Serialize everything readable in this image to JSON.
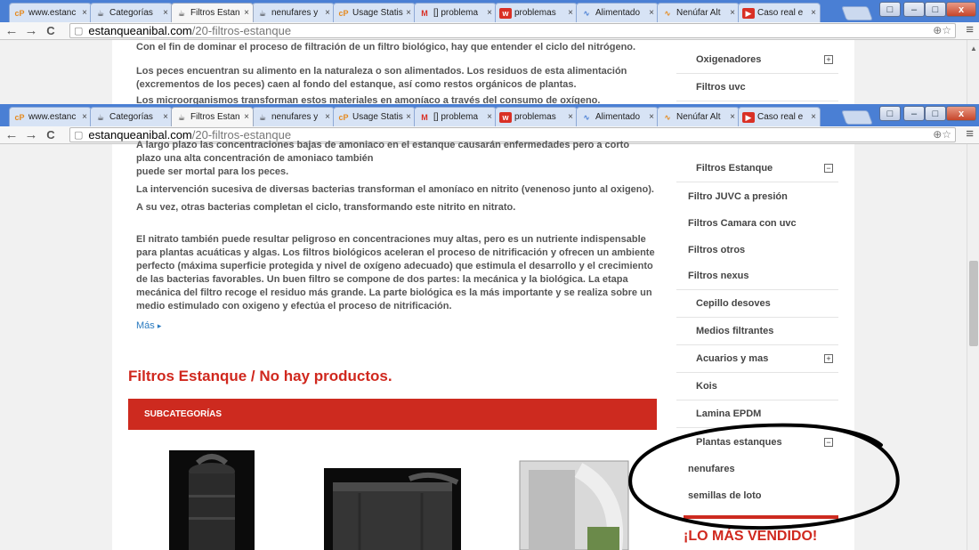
{
  "browser": {
    "tabs": [
      {
        "label": "www.estanc",
        "favicon": "cP"
      },
      {
        "label": "Categorías",
        "favicon": "☕"
      },
      {
        "label": "Filtros Estan",
        "favicon": "☕",
        "active": true
      },
      {
        "label": "nenufares y",
        "favicon": "☕"
      },
      {
        "label": "Usage Statis",
        "favicon": "cP"
      },
      {
        "label": "[] problema",
        "favicon": "M"
      },
      {
        "label": "problemas",
        "favicon": "w"
      },
      {
        "label": "Alimentado",
        "favicon": "∿"
      },
      {
        "label": "Nenúfar Alt",
        "favicon": "∿"
      },
      {
        "label": "Caso real e",
        "favicon": "▶"
      }
    ],
    "tab_close": "×",
    "url_host": "estanqueanibal.com",
    "url_path": "/20-filtros-estanque",
    "omnibox_icons": "⊕☆",
    "menu_icon": "≡",
    "nav": {
      "back": "←",
      "forward": "→",
      "reload": "C"
    },
    "window": {
      "minimize": "–",
      "maximize": "□",
      "close": "x"
    }
  },
  "back_view": {
    "paragraphs": [
      "Con el fin de dominar el proceso de filtración de un filtro biológico, hay que entender el ciclo del nitrógeno.",
      "Los peces encuentran su alimento en la naturaleza o son alimentados. Los residuos de esta alimentación (excrementos de los peces) caen al fondo del estanque, así como restos orgánicos de plantas.",
      "Los microorganismos transforman estos materiales en amoníaco a través del consumo de oxígeno."
    ],
    "sidebar": [
      {
        "label": "Oxigenadores",
        "toggle": "+"
      },
      {
        "label": "Filtros uvc"
      }
    ]
  },
  "front_view": {
    "paragraphs": [
      "A largo plazo las concentraciones bajas de amoniaco en el estanque causarán enfermedades pero a corto plazo una alta concentración de amoniaco también",
      "puede ser mortal para los peces.",
      "La intervención sucesiva de diversas bacterias transforman el amoníaco en nitrito (venenoso junto al oxigeno).",
      "A su vez, otras bacterias completan el ciclo, transformando este nitrito en nitrato.",
      "El nitrato también puede resultar peligroso en concentraciones muy altas, pero es un nutriente indispensable para plantas acuáticas y algas. Los filtros biológicos aceleran el proceso de nitrificación y ofrecen un ambiente perfecto (máxima superficie protegida y nivel de oxígeno adecuado) que estimula el desarrollo y el crecimiento de las bacterias favorables. Un buen filtro se compone de dos partes: la mecánica y la biológica. La etapa mecánica del filtro recoge el residuo más grande. La parte biológica es la más importante y se realiza sobre un medio estimulado con oxigeno y efectúa el proceso de nitrificación."
    ],
    "more_link": "Más",
    "more_arrow": "▸",
    "section_title": "Filtros Estanque  / No hay productos.",
    "subcategories_label": "SUBCATEGORÍAS",
    "sidebar": [
      {
        "label": "Filtros Estanque",
        "toggle": "−",
        "level": 2
      },
      {
        "label": "Filtro JUVC a presión",
        "level": 3
      },
      {
        "label": "Filtros Camara con uvc",
        "level": 3
      },
      {
        "label": "Filtros otros",
        "level": 3
      },
      {
        "label": "Filtros nexus",
        "level": 3
      },
      {
        "label": "Cepillo desoves",
        "level": 2
      },
      {
        "label": "Medios filtrantes",
        "level": 2
      },
      {
        "label": "Acuarios y mas",
        "toggle": "+",
        "level": 2
      },
      {
        "label": "Kois",
        "level": 2
      },
      {
        "label": "Lamina EPDM",
        "level": 2
      },
      {
        "label": "Plantas estanques",
        "toggle": "−",
        "level": 2
      },
      {
        "label": "nenufares",
        "level": 3
      },
      {
        "label": "semillas de loto",
        "level": 3
      }
    ],
    "bestsellers_title": "¡LO MÁS VENDIDO!"
  },
  "colors": {
    "accent_red": "#cd2a1f",
    "link_blue": "#2b7bc0",
    "tabstrip_blue": "#4a7fd4"
  }
}
